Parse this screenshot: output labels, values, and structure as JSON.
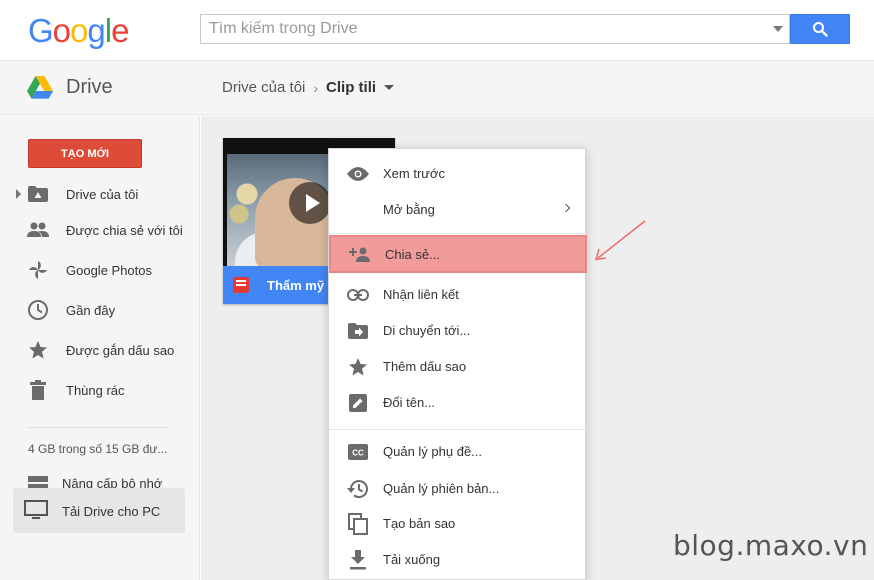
{
  "brand": {
    "logo_letters": [
      "G",
      "o",
      "o",
      "g",
      "l",
      "e"
    ],
    "logo_colors": [
      "#4285f4",
      "#ea4335",
      "#fbbc05",
      "#4285f4",
      "#34a853",
      "#ea4335"
    ]
  },
  "search": {
    "placeholder": "Tìm kiếm trong Drive",
    "button_icon": "search-icon",
    "accent": "#4285f4"
  },
  "header": {
    "app_title": "Drive",
    "breadcrumb": [
      "Drive của tôi",
      "Clip tili"
    ]
  },
  "sidebar": {
    "new_button": "TẠO MỚI",
    "new_button_color": "#dd4b39",
    "items": [
      {
        "label": "Drive của tôi",
        "icon": "drive-folder-icon"
      },
      {
        "label": "Được chia sẻ với tôi",
        "icon": "people-icon"
      },
      {
        "label": "Google Photos",
        "icon": "photos-pinwheel-icon"
      },
      {
        "label": "Gần đây",
        "icon": "clock-icon"
      },
      {
        "label": "Được gắn dấu sao",
        "icon": "star-icon"
      },
      {
        "label": "Thùng rác",
        "icon": "trash-icon"
      }
    ],
    "storage": "4 GB trong số 15 GB đư...",
    "upgrade": "Nâng cấp bộ nhớ",
    "download_pc": "Tải Drive cho PC"
  },
  "file": {
    "name": "Thẩm mỹ v",
    "type_icon": "video-file-icon",
    "bar_color": "#4285f4"
  },
  "context_menu": {
    "items": [
      {
        "label": "Xem trước",
        "icon": "eye-icon"
      },
      {
        "label": "Mở bằng",
        "icon": "",
        "submenu": true
      },
      {
        "label": "Chia sẻ...",
        "icon": "add-person-icon",
        "highlighted": true
      },
      {
        "label": "Nhận liên kết",
        "icon": "link-icon"
      },
      {
        "label": "Di chuyển tới...",
        "icon": "move-folder-icon"
      },
      {
        "label": "Thêm dấu sao",
        "icon": "star-icon"
      },
      {
        "label": "Đổi tên...",
        "icon": "pencil-icon"
      },
      {
        "label": "Quản lý phụ đề...",
        "icon": "cc-icon"
      },
      {
        "label": "Quản lý phiên bản...",
        "icon": "history-icon"
      },
      {
        "label": "Tạo bản sao",
        "icon": "copy-icon"
      },
      {
        "label": "Tải xuống",
        "icon": "download-icon"
      }
    ],
    "highlight_color": "#f29b9b"
  },
  "watermark": "blog.maxo.vn"
}
